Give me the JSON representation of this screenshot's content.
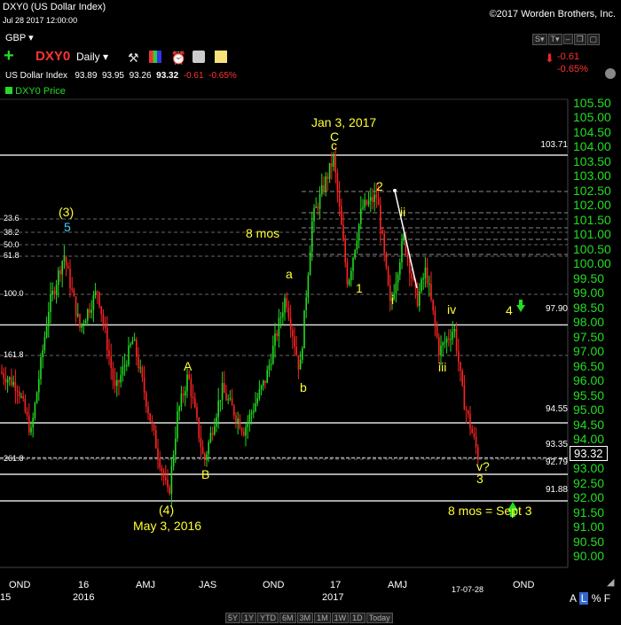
{
  "header": {
    "symbol_title": "DXY0 (US Dollar Index)",
    "datetime": "Jul 28 2017 12:00:00",
    "copyright": "©2017 Worden Brothers, Inc.",
    "currency": "GBP"
  },
  "toolbar": {
    "symbol": "DXY0",
    "period": "Daily",
    "change": "-0.61",
    "change_pct": "-0.65%"
  },
  "quote": {
    "name": "US Dollar Index",
    "open": "93.89",
    "high": "93.95",
    "low": "93.26",
    "close": "93.32",
    "change": "-0.61",
    "change_pct": "-0.65%"
  },
  "legend": {
    "series": "DXY0 Price"
  },
  "chart_data": {
    "type": "candlestick",
    "y_ticks": [
      "105.50",
      "105.00",
      "104.50",
      "104.00",
      "103.50",
      "103.00",
      "102.50",
      "102.00",
      "101.50",
      "101.00",
      "100.50",
      "100.00",
      "99.50",
      "99.00",
      "98.50",
      "98.00",
      "97.50",
      "97.00",
      "96.50",
      "96.00",
      "95.50",
      "95.00",
      "94.50",
      "94.00",
      "93.50",
      "93.00",
      "92.50",
      "92.00",
      "91.50",
      "91.00",
      "90.50",
      "90.00"
    ],
    "x_ticks": [
      "OND",
      "16",
      "AMJ",
      "JAS",
      "OND",
      "17",
      "AMJ",
      "OND"
    ],
    "x_subticks": [
      "15",
      "2016",
      "2017"
    ],
    "last_price": "93.32",
    "last_date_label": "17-07-28",
    "hlines": [
      "103.71",
      "97.90",
      "94.55",
      "93.35",
      "92.79",
      "91.88"
    ],
    "fib_labels": [
      "23.6",
      "38.2",
      "50.0",
      "61.8",
      "100.0",
      "161.8",
      "261.8"
    ],
    "annotations": {
      "jan3": "Jan 3, 2017",
      "C_big": "C",
      "c_small": "c",
      "w2": "2",
      "wii": "ii",
      "w3p": "(3)",
      "w5": "5",
      "mos8_top": "8 mos",
      "wa": "a",
      "w1": "1",
      "wi": "i",
      "w4": "4",
      "wiv": "iv",
      "wA": "A",
      "wb": "b",
      "wiii": "iii",
      "wB": "B",
      "wv": "v?",
      "w3": "3",
      "w4p": "(4)",
      "may3": "May 3, 2016",
      "mos8_bottom": "8 mos = Sept 3"
    }
  },
  "footer": {
    "timeframes": [
      "5Y",
      "1Y",
      "YTD",
      "6M",
      "3M",
      "1M",
      "1W",
      "1D",
      "Today"
    ],
    "scale_buttons": [
      "A",
      "L",
      "%",
      "F"
    ]
  },
  "colors": {
    "up": "#22dd22",
    "down": "#ff2222",
    "accent": "#ffff33",
    "axis": "#22dd22"
  }
}
